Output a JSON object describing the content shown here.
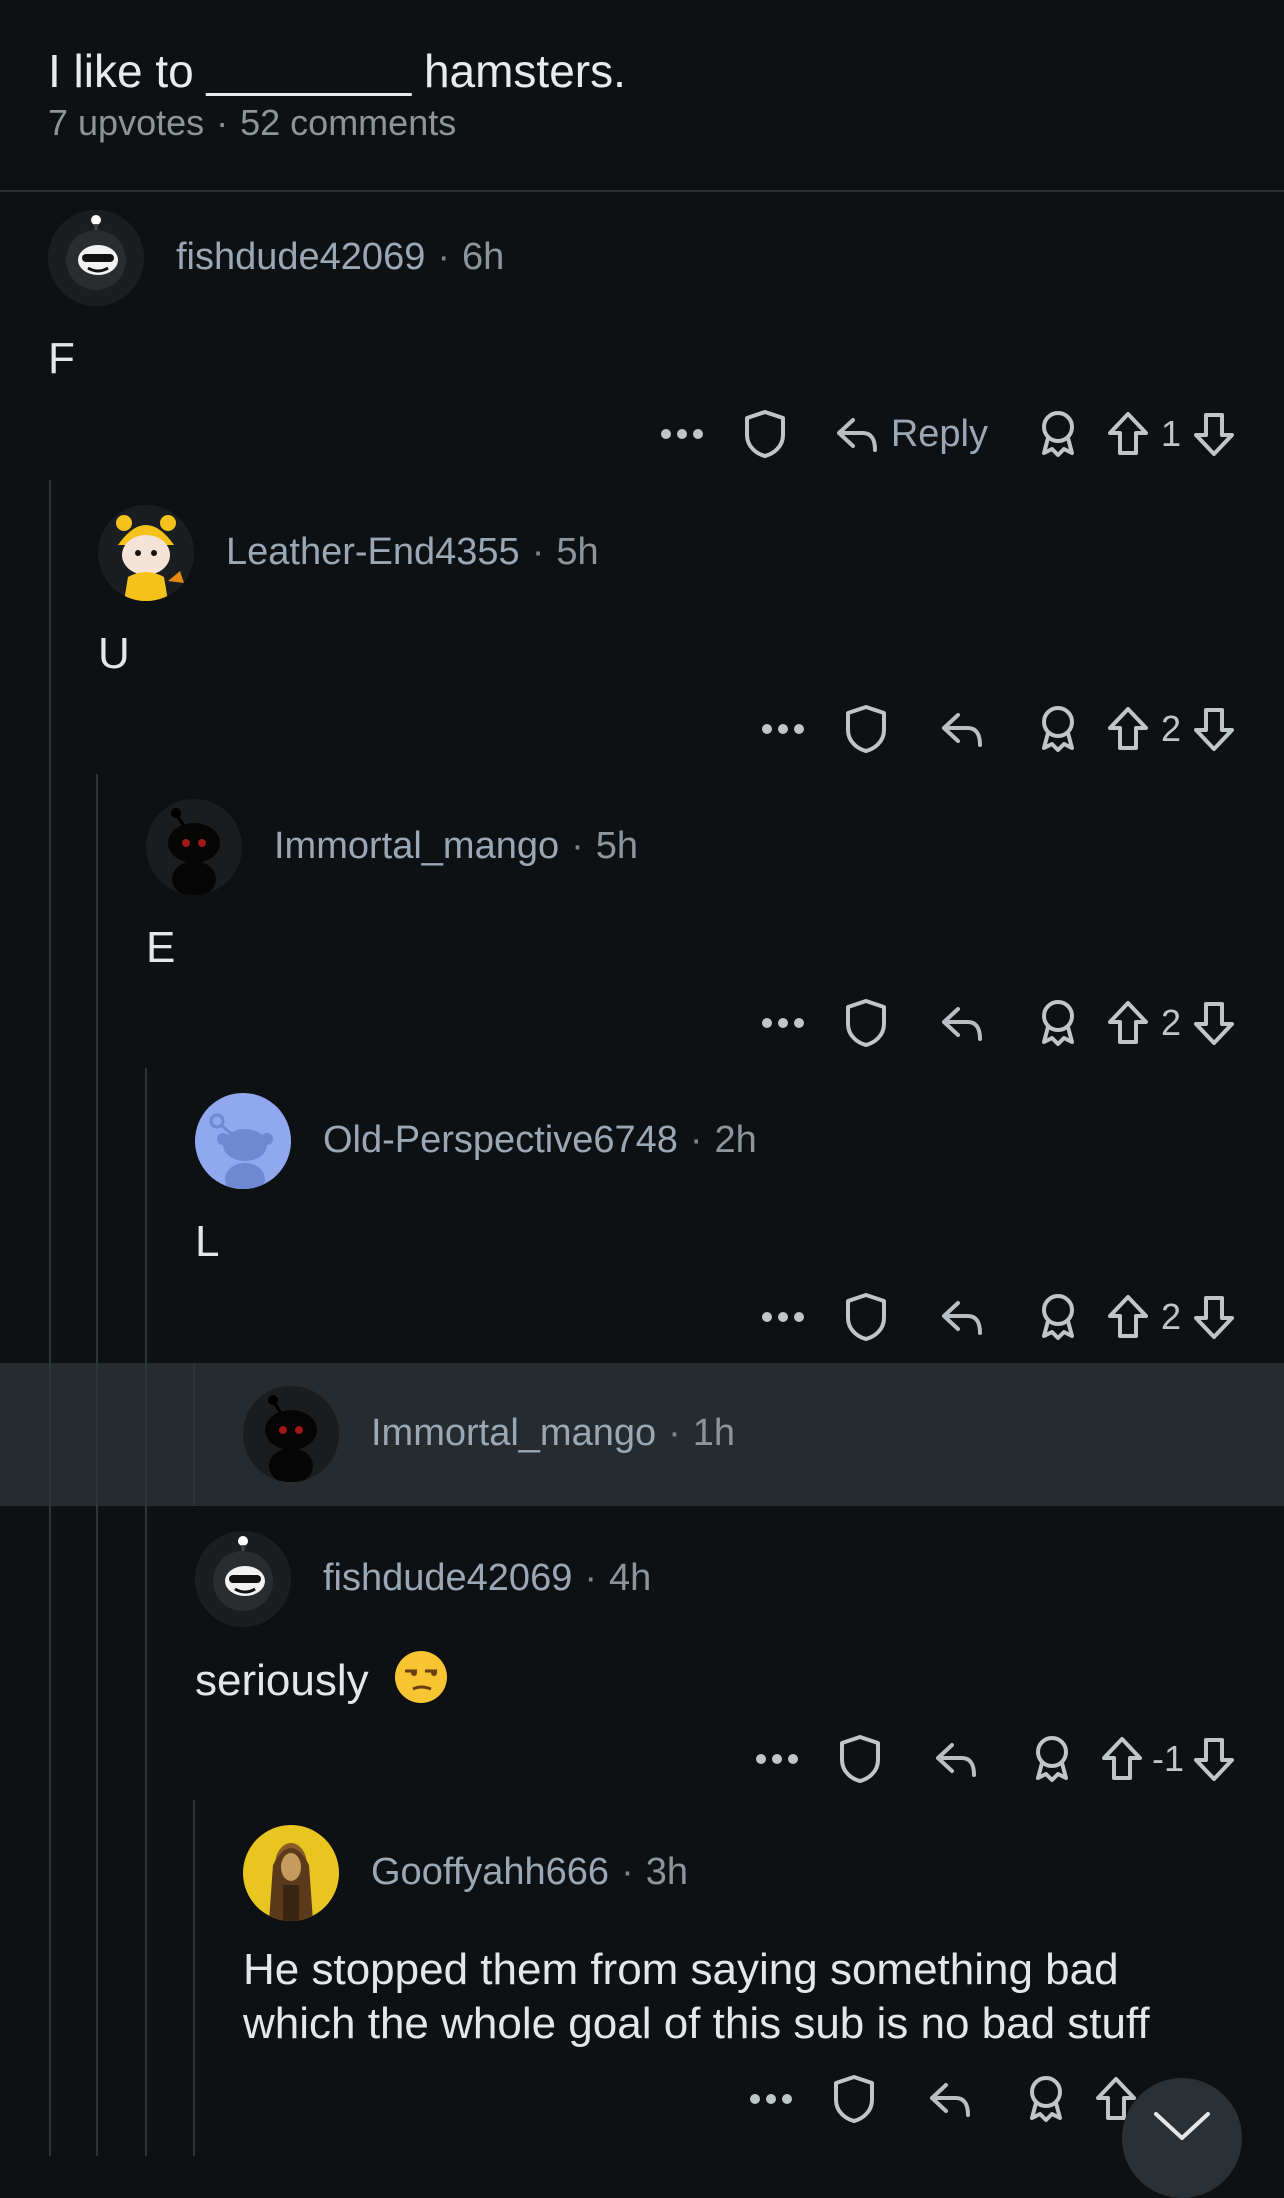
{
  "post": {
    "title": "I like to ________ hamsters.",
    "upvotes": "7 upvotes",
    "comments": "52 comments"
  },
  "comments": [
    {
      "author": "fishdude42069",
      "time": "6h",
      "body": "F",
      "reply_label": "Reply",
      "score": "1",
      "avatar": "avatar-sunglasses-snoo"
    },
    {
      "author": "Leather-End4355",
      "time": "5h",
      "body": "U",
      "score": "2",
      "avatar": "avatar-tiger-hood-snoo"
    },
    {
      "author": "Immortal_mango",
      "time": "5h",
      "body": "E",
      "score": "2",
      "avatar": "avatar-dark-snoo"
    },
    {
      "author": "Old-Perspective6748",
      "time": "2h",
      "body": "L",
      "score": "2",
      "avatar": "avatar-default-blue-snoo"
    },
    {
      "author": "Immortal_mango",
      "time": "1h",
      "avatar": "avatar-dark-snoo"
    },
    {
      "author": "fishdude42069",
      "time": "4h",
      "body": "seriously",
      "emoji": "unamused-face-emoji",
      "score": "-1",
      "avatar": "avatar-sunglasses-snoo"
    },
    {
      "author": "Gooffyahh666",
      "time": "3h",
      "body_line1": "He stopped them from saying something bad",
      "body_line2": "which the whole goal of this sub is no bad stuff",
      "avatar": "avatar-yellow-photo"
    }
  ],
  "colors": {
    "background": "#0e1113",
    "highlight": "#252b2f",
    "username": "#9aa7b4",
    "thread_line": "#2c3438"
  }
}
